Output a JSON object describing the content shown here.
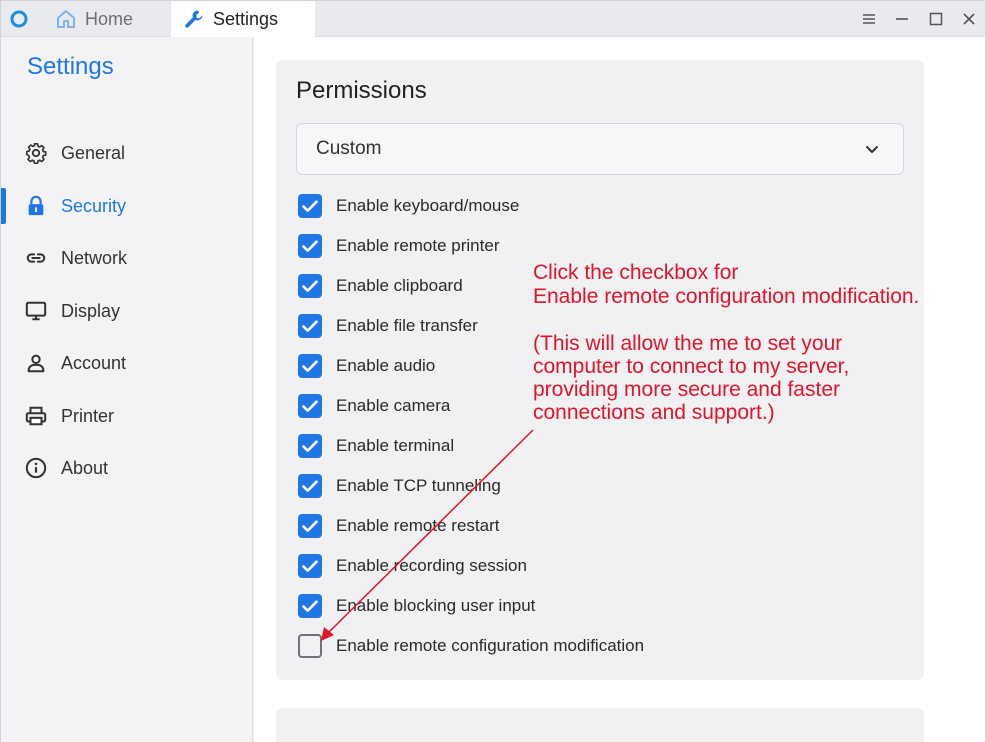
{
  "titlebar": {
    "tabs": [
      {
        "label": "Home",
        "icon": "home-icon"
      },
      {
        "label": "Settings",
        "icon": "wrench-icon"
      }
    ],
    "window_controls": [
      "menu-icon",
      "minimize-icon",
      "maximize-icon",
      "close-icon"
    ]
  },
  "sidebar": {
    "title": "Settings",
    "items": [
      {
        "label": "General",
        "icon": "gear-icon"
      },
      {
        "label": "Security",
        "icon": "lock-icon",
        "active": true
      },
      {
        "label": "Network",
        "icon": "link-icon"
      },
      {
        "label": "Display",
        "icon": "monitor-icon"
      },
      {
        "label": "Account",
        "icon": "person-icon"
      },
      {
        "label": "Printer",
        "icon": "printer-icon"
      },
      {
        "label": "About",
        "icon": "info-icon"
      }
    ]
  },
  "permissions": {
    "title": "Permissions",
    "preset": "Custom",
    "options": [
      {
        "label": "Enable keyboard/mouse",
        "checked": true
      },
      {
        "label": "Enable remote printer",
        "checked": true
      },
      {
        "label": "Enable clipboard",
        "checked": true
      },
      {
        "label": "Enable file transfer",
        "checked": true
      },
      {
        "label": "Enable audio",
        "checked": true
      },
      {
        "label": "Enable camera",
        "checked": true
      },
      {
        "label": "Enable terminal",
        "checked": true
      },
      {
        "label": "Enable TCP tunneling",
        "checked": true
      },
      {
        "label": "Enable remote restart",
        "checked": true
      },
      {
        "label": "Enable recording session",
        "checked": true
      },
      {
        "label": "Enable blocking user input",
        "checked": true
      },
      {
        "label": "Enable remote configuration modification",
        "checked": false
      }
    ]
  },
  "annotation": {
    "lines": [
      "Click the checkbox for",
      "Enable remote configuration modification.",
      "(This will allow the me to set your",
      "computer to connect to my server,",
      "providing more secure and faster",
      "connections and support.)"
    ],
    "color": "#e2142a"
  },
  "colors": {
    "accent": "#1f77e6",
    "annotation": "#e2142a"
  }
}
